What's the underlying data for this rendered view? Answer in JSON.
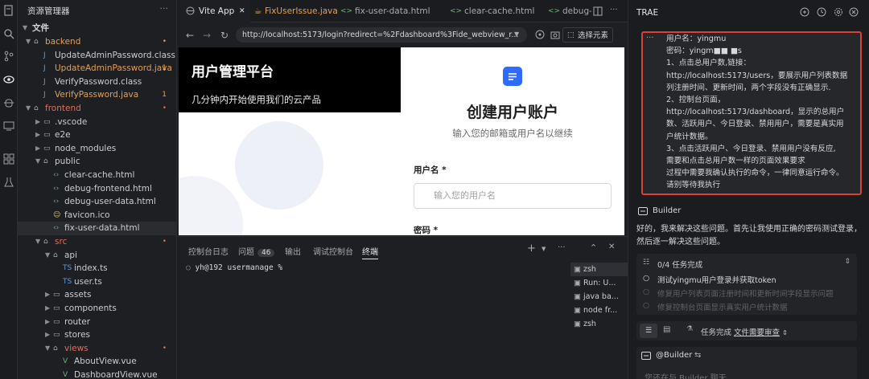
{
  "colors": {
    "accent": "#2f6bff",
    "highlight_border": "#e0402f",
    "modified": "#e2a05a",
    "error": "#e06c5a"
  },
  "activity_bar": {
    "icons": [
      "files-icon",
      "search-icon",
      "source-control-icon",
      "preview-icon",
      "debug-icon",
      "remote-icon",
      "extensions-icon",
      "testing-icon"
    ]
  },
  "explorer": {
    "title": "资源管理器",
    "more": "···",
    "section": "文件",
    "rows": [
      {
        "label": "backend",
        "type": "folder",
        "open": true,
        "indent": 0,
        "state": "modified",
        "mark": "•"
      },
      {
        "label": "UpdateAdminPassword.class",
        "type": "java",
        "indent": 1,
        "state": "normal",
        "mark": ""
      },
      {
        "label": "UpdateAdminPassword.java",
        "type": "java",
        "indent": 1,
        "state": "modified",
        "mark": "1"
      },
      {
        "label": "VerifyPassword.class",
        "type": "java",
        "indent": 1,
        "state": "normal",
        "mark": ""
      },
      {
        "label": "VerifyPassword.java",
        "type": "java",
        "indent": 1,
        "state": "modified",
        "mark": "1"
      },
      {
        "label": "frontend",
        "type": "folder",
        "open": true,
        "indent": 0,
        "state": "error",
        "mark": "•"
      },
      {
        "label": ".vscode",
        "type": "folder",
        "open": false,
        "indent": 1,
        "state": "normal",
        "mark": ""
      },
      {
        "label": "e2e",
        "type": "folder",
        "open": false,
        "indent": 1,
        "state": "normal",
        "mark": ""
      },
      {
        "label": "node_modules",
        "type": "folder",
        "open": false,
        "indent": 1,
        "state": "normal",
        "mark": ""
      },
      {
        "label": "public",
        "type": "folder",
        "open": true,
        "indent": 1,
        "state": "normal",
        "mark": ""
      },
      {
        "label": "clear-cache.html",
        "type": "html",
        "indent": 2,
        "state": "normal",
        "mark": ""
      },
      {
        "label": "debug-frontend.html",
        "type": "html",
        "indent": 2,
        "state": "normal",
        "mark": ""
      },
      {
        "label": "debug-user-data.html",
        "type": "html",
        "indent": 2,
        "state": "normal",
        "mark": ""
      },
      {
        "label": "favicon.ico",
        "type": "ico",
        "indent": 2,
        "state": "normal",
        "mark": ""
      },
      {
        "label": "fix-user-data.html",
        "type": "html",
        "indent": 2,
        "state": "selected",
        "mark": ""
      },
      {
        "label": "src",
        "type": "folder",
        "open": true,
        "indent": 1,
        "state": "error",
        "mark": "•"
      },
      {
        "label": "api",
        "type": "folder",
        "open": true,
        "indent": 2,
        "state": "normal",
        "mark": ""
      },
      {
        "label": "index.ts",
        "type": "ts",
        "indent": 3,
        "state": "normal",
        "mark": ""
      },
      {
        "label": "user.ts",
        "type": "ts",
        "indent": 3,
        "state": "normal",
        "mark": ""
      },
      {
        "label": "assets",
        "type": "folder",
        "open": false,
        "indent": 2,
        "state": "normal",
        "mark": ""
      },
      {
        "label": "components",
        "type": "folder",
        "open": false,
        "indent": 2,
        "state": "normal",
        "mark": ""
      },
      {
        "label": "router",
        "type": "folder",
        "open": false,
        "indent": 2,
        "state": "normal",
        "mark": ""
      },
      {
        "label": "stores",
        "type": "folder",
        "open": false,
        "indent": 2,
        "state": "normal",
        "mark": ""
      },
      {
        "label": "views",
        "type": "folder",
        "open": true,
        "indent": 2,
        "state": "error",
        "mark": "•"
      },
      {
        "label": "AboutView.vue",
        "type": "vue",
        "indent": 3,
        "state": "normal",
        "mark": ""
      },
      {
        "label": "DashboardView.vue",
        "type": "vue",
        "indent": 3,
        "state": "normal",
        "mark": ""
      }
    ]
  },
  "tabs": [
    {
      "label": "Vite App",
      "icon": "globe-icon",
      "active": true,
      "close": "✕"
    },
    {
      "label": "FixUserIssue.java",
      "icon": "java-icon",
      "active": false,
      "modified": true
    },
    {
      "label": "fix-user-data.html",
      "icon": "html-icon",
      "active": false
    },
    {
      "label": "clear-cache.html",
      "icon": "html-icon",
      "active": false
    },
    {
      "label": "debug-",
      "icon": "html-icon",
      "active": false
    }
  ],
  "browser": {
    "url": "http://localhost:5173/login?redirect=%2Fdashboard%3Fide_webview_r...",
    "select_element": "选择元素"
  },
  "webpage": {
    "banner_title": "用户管理平台",
    "banner_subtitle": "几分钟内开始使用我们的云产品",
    "form_title": "创建用户账户",
    "form_subtitle": "输入您的邮箱或用户名以继续",
    "username_label": "用户名 *",
    "username_placeholder": "输入您的用户名",
    "password_label": "密码 *"
  },
  "panel": {
    "tabs": [
      {
        "label": "控制台日志",
        "active": false
      },
      {
        "label": "问题",
        "badge": "46",
        "active": false
      },
      {
        "label": "输出",
        "active": false
      },
      {
        "label": "调试控制台",
        "active": false
      },
      {
        "label": "终端",
        "active": true
      }
    ],
    "terminal_prompt": "yh@192 usermanage %",
    "terminals": [
      {
        "label": "zsh",
        "selected": true
      },
      {
        "label": "Run: U...",
        "selected": false
      },
      {
        "label": "java ba...",
        "selected": false
      },
      {
        "label": "node fr...",
        "selected": false
      },
      {
        "label": "zsh",
        "selected": false
      }
    ]
  },
  "trae": {
    "title": "TRAE",
    "message_lines": [
      "用户名：yingmu",
      "密码：yingm■■ ■s",
      "1、点击总用户数,链接：",
      "http://localhost:5173/users，要展示用户列表数据",
      "列注册时间、更新时间，两个字段没有正确显示.",
      "2、控制台页面，",
      "http://localhost:5173/dashboard，显示的总用户",
      "数、活跃用户、今日登录、禁用用户，需要是真实用",
      "户统计数据。",
      "3、点击活跃用户、今日登录、禁用用户没有反应,",
      "需要和点击总用户数一样的页面效果要求",
      "过程中需要我确认执行的命令，一律同意运行命令。",
      "请别等待我执行"
    ],
    "builder_name": "Builder",
    "reply": "好的，我来解决这些问题。首先让我使用正确的密码测试登录，然后逐一解决这些问题。",
    "task_header": "0/4 任务完成",
    "tasks": [
      {
        "label": "测试yingmu用户登录并获取token",
        "active": true
      },
      {
        "label": "修复用户列表页面注册时间和更新时间字段显示问题",
        "active": false
      },
      {
        "label": "修复控制台页面显示真实用户统计数据",
        "active": false
      }
    ],
    "status_text": "任务完成",
    "review_link": "文件需要审查",
    "input_mention": "@Builder",
    "input_placeholder": "您还在与 Builder 聊天"
  }
}
